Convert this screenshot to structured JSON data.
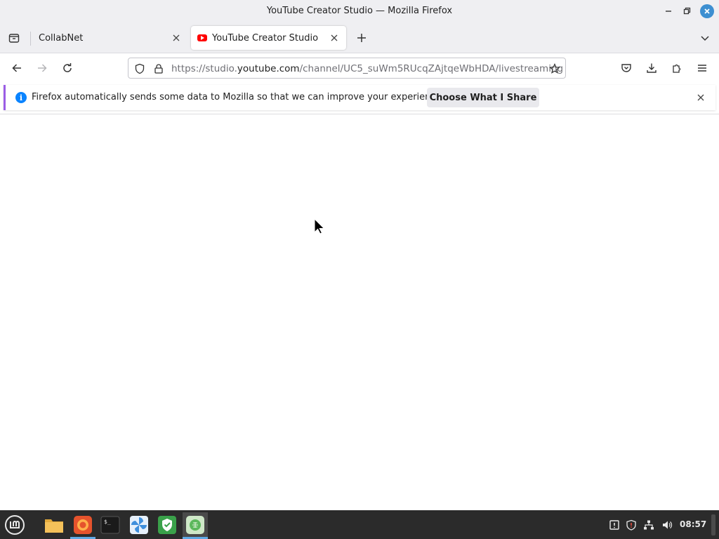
{
  "window": {
    "title": "YouTube Creator Studio — Mozilla Firefox"
  },
  "tabs": [
    {
      "label": "CollabNet",
      "active": false
    },
    {
      "label": "YouTube Creator Studio",
      "active": true
    }
  ],
  "urlbar": {
    "prefix": "https://studio.",
    "host": "youtube.com",
    "path": "/channel/UC5_suWm5RUcqZAjtqeWbHDA/livestreaming"
  },
  "notification": {
    "message": "Firefox automatically sends some data to Mozilla so that we can improve your experience.",
    "button_label": "Choose What I Share"
  },
  "taskbar": {
    "apps": [
      {
        "name": "menu-icon"
      },
      {
        "name": "files-icon"
      },
      {
        "name": "firefox-icon",
        "active": true
      },
      {
        "name": "terminal-icon"
      },
      {
        "name": "pinwheel-app-icon"
      },
      {
        "name": "shield-app-icon"
      },
      {
        "name": "grid-app-icon",
        "highlight": true
      }
    ],
    "clock": "08:57"
  },
  "colors": {
    "accent": "#3d8fd1",
    "notification_border": "#9b5de5",
    "info_blue": "#0a84ff",
    "taskbar_bg": "#2b2b2b"
  }
}
